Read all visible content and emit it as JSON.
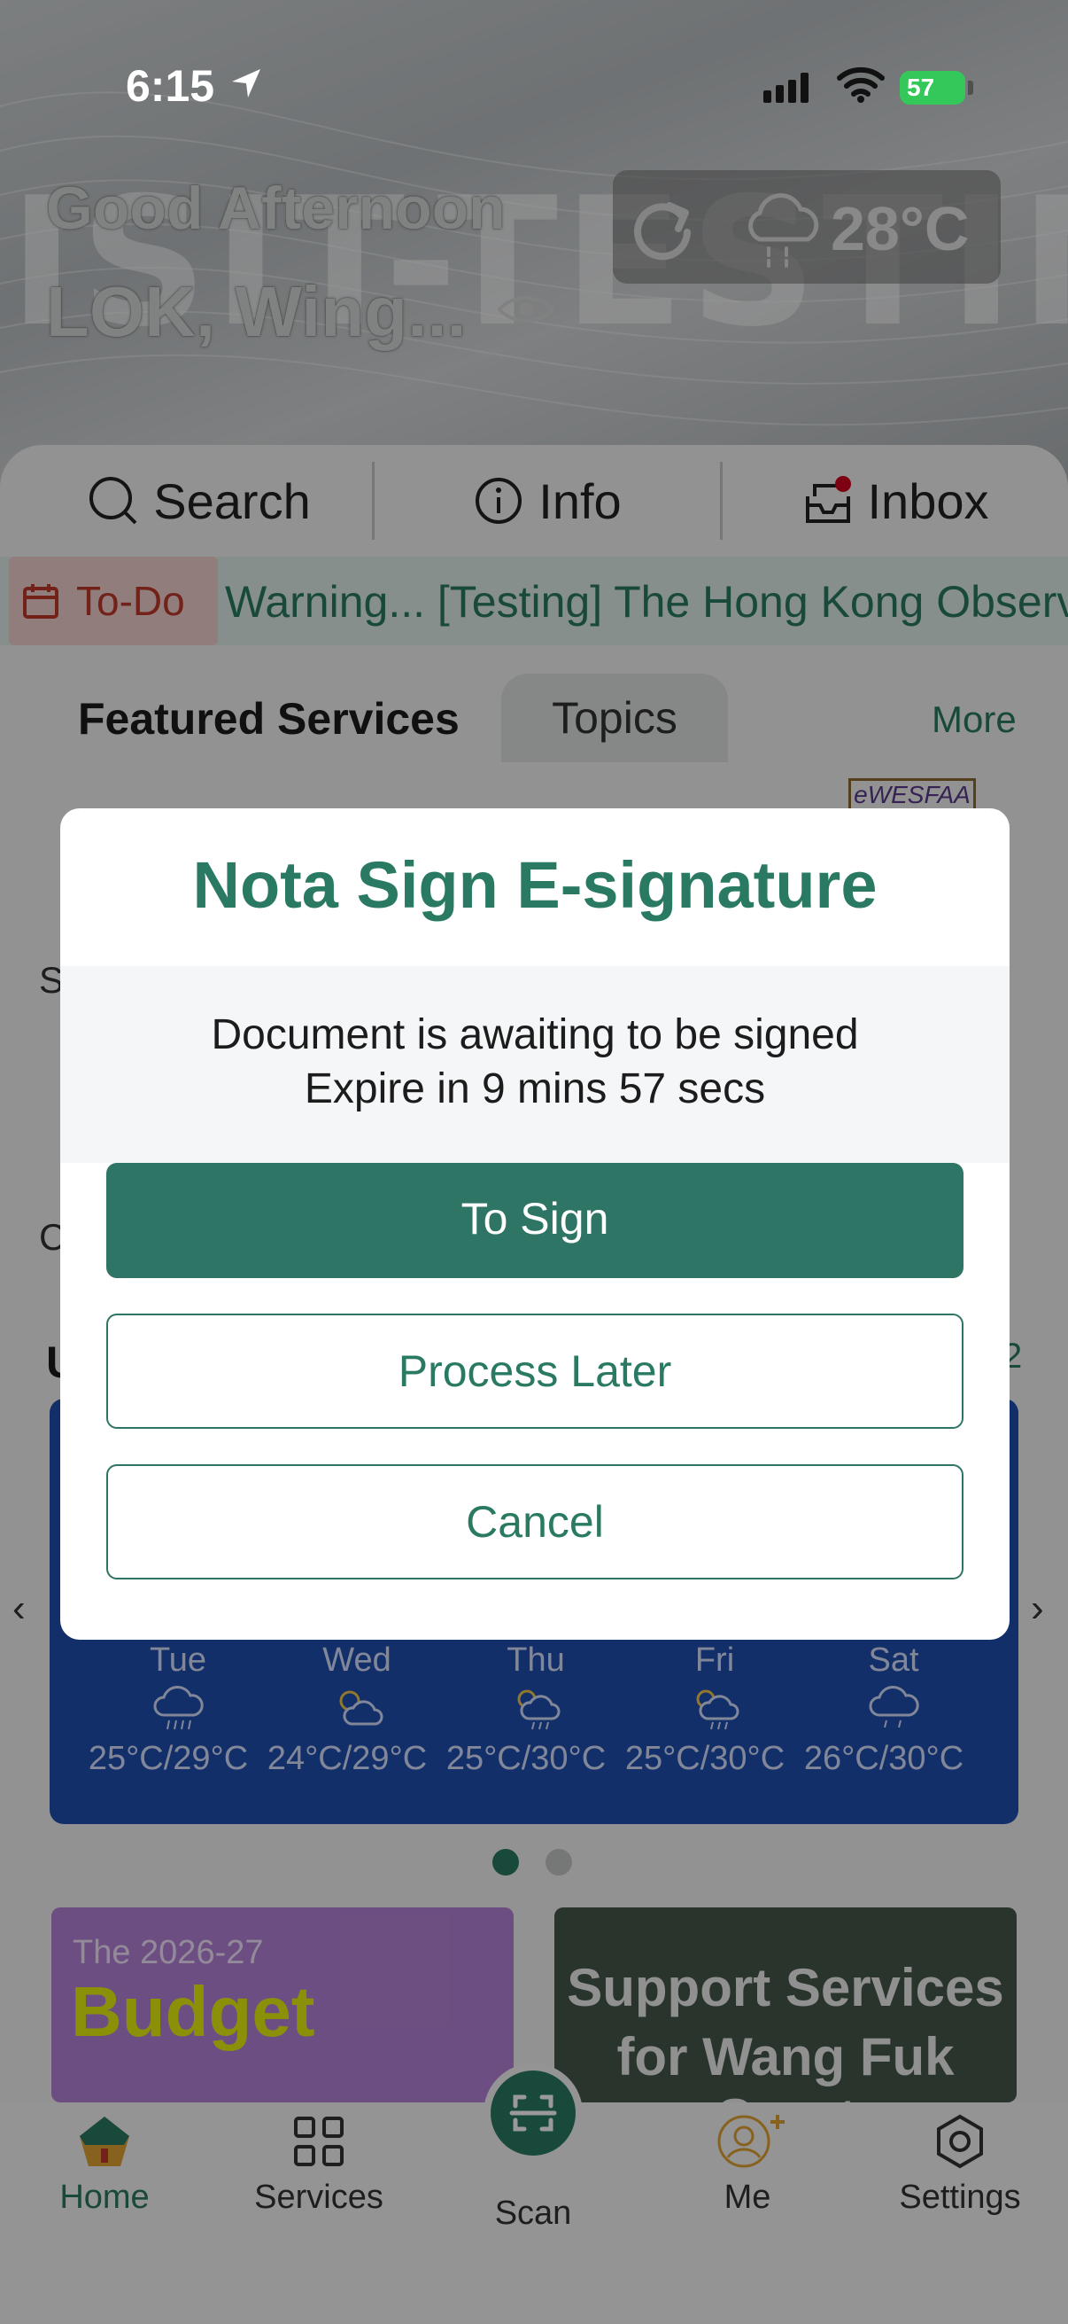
{
  "status_bar": {
    "time": "6:15",
    "battery": "57"
  },
  "header": {
    "greeting": "Good Afternoon",
    "user_name": "LOK, Wing...",
    "watermark": "ISIT-TESTING",
    "temperature": "28°C"
  },
  "quick_bar": {
    "items": [
      {
        "label": "Search",
        "icon": "search-icon"
      },
      {
        "label": "Info",
        "icon": "info-icon"
      },
      {
        "label": "Inbox",
        "icon": "inbox-icon"
      }
    ]
  },
  "ticker": {
    "todo_label": "To-Do",
    "text": "Warning...   [Testing] The Hong Kong Observatory"
  },
  "section_tabs": {
    "featured": "Featured Services",
    "topics": "Topics",
    "more": "More"
  },
  "fragments": {
    "s": "S",
    "c": "C",
    "u": "U",
    "page_count": "2",
    "ewesfaa": "eWESFAA"
  },
  "forecast": [
    {
      "day": "Tue",
      "temp": "25°C/29°C",
      "icon": "rain-cloud-icon"
    },
    {
      "day": "Wed",
      "temp": "24°C/29°C",
      "icon": "sun-cloud-icon"
    },
    {
      "day": "Thu",
      "temp": "25°C/30°C",
      "icon": "sun-rain-icon"
    },
    {
      "day": "Fri",
      "temp": "25°C/30°C",
      "icon": "sun-rain-icon"
    },
    {
      "day": "Sat",
      "temp": "26°C/30°C",
      "icon": "rain-cloud-icon"
    }
  ],
  "banners": {
    "budget_year": "The 2026-27",
    "budget_word": "Budget",
    "support_line1": "Support Services",
    "support_line2": "for Wang Fuk Court"
  },
  "tab_bar": {
    "home": "Home",
    "services": "Services",
    "scan": "Scan",
    "me": "Me",
    "settings": "Settings"
  },
  "modal": {
    "title": "Nota Sign E-signature",
    "message_line1": "Document is awaiting to be signed",
    "message_line2": "Expire in 9 mins 57 secs",
    "to_sign": "To Sign",
    "process_later": "Process Later",
    "cancel": "Cancel"
  },
  "colors": {
    "primary": "#2e7565",
    "accent_text": "#2a7a63",
    "weather_card": "#1f4fb0",
    "todo_red": "#c0392b"
  }
}
